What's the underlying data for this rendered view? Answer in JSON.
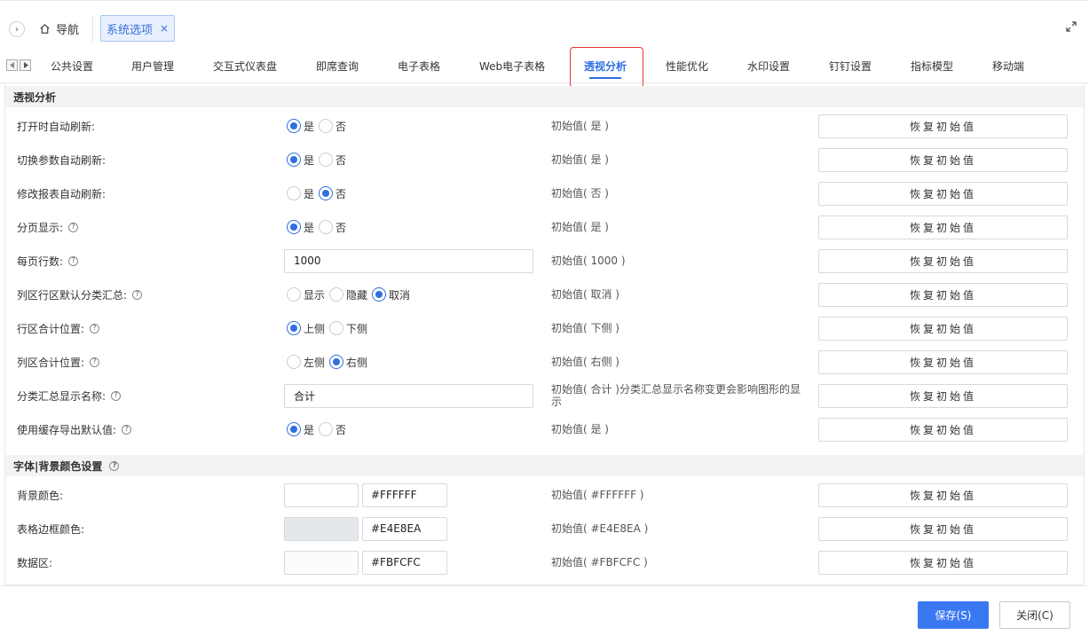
{
  "topbar": {
    "nav_label": "导航",
    "open_tab_label": "系统选项",
    "close_glyph": "×",
    "toggle_glyph": "›"
  },
  "tabs": [
    {
      "label": "公共设置"
    },
    {
      "label": "用户管理"
    },
    {
      "label": "交互式仪表盘"
    },
    {
      "label": "即席查询"
    },
    {
      "label": "电子表格"
    },
    {
      "label": "Web电子表格"
    },
    {
      "label": "透视分析",
      "active": true
    },
    {
      "label": "性能优化"
    },
    {
      "label": "水印设置"
    },
    {
      "label": "钉钉设置"
    },
    {
      "label": "指标模型"
    },
    {
      "label": "移动端"
    }
  ],
  "section1": {
    "title": "透视分析"
  },
  "rows": [
    {
      "label": "打开时自动刷新:",
      "options": [
        "是",
        "否"
      ],
      "selected": 0,
      "initial": "初始值( 是 )"
    },
    {
      "label": "切换参数自动刷新:",
      "options": [
        "是",
        "否"
      ],
      "selected": 0,
      "initial": "初始值( 是 )"
    },
    {
      "label": "修改报表自动刷新:",
      "options": [
        "是",
        "否"
      ],
      "selected": 1,
      "initial": "初始值( 否 )"
    },
    {
      "label": "分页显示:",
      "options": [
        "是",
        "否"
      ],
      "selected": 0,
      "initial": "初始值( 是 )",
      "help": true
    },
    {
      "label": "每页行数:",
      "value": "1000",
      "initial": "初始值( 1000 )",
      "help": true
    },
    {
      "label": "列区行区默认分类汇总:",
      "options": [
        "显示",
        "隐藏",
        "取消"
      ],
      "selected": 2,
      "initial": "初始值( 取消 )",
      "help": true
    },
    {
      "label": "行区合计位置:",
      "options": [
        "上侧",
        "下侧"
      ],
      "selected": 0,
      "initial": "初始值( 下侧 )",
      "help": true
    },
    {
      "label": "列区合计位置:",
      "options": [
        "左侧",
        "右侧"
      ],
      "selected": 1,
      "initial": "初始值( 右侧 )",
      "help": true
    },
    {
      "label": "分类汇总显示名称:",
      "value": "合计",
      "initial": "初始值( 合计 )分类汇总显示名称变更会影响图形的显示",
      "help": true
    },
    {
      "label": "使用缓存导出默认值:",
      "options": [
        "是",
        "否"
      ],
      "selected": 0,
      "initial": "初始值( 是 )",
      "help": true
    }
  ],
  "section2": {
    "title": "字体|背景颜色设置"
  },
  "color_rows": [
    {
      "label": "背景颜色:",
      "color": "#FFFFFF",
      "value": "#FFFFFF",
      "initial": "初始值( #FFFFFF )"
    },
    {
      "label": "表格边框颜色:",
      "color": "#E4E8EA",
      "value": "#E4E8EA",
      "initial": "初始值( #E4E8EA )"
    },
    {
      "label": "数据区:",
      "color": "#FBFCFC",
      "value": "#FBFCFC",
      "initial": "初始值( #FBFCFC )"
    }
  ],
  "reset_label": "恢复初始值",
  "footer": {
    "save_label": "保存(S)",
    "close_label": "关闭(C)"
  },
  "colors": {
    "accent": "#2f6fe0",
    "save_button": "#3a78f2",
    "highlight": "#e53935"
  }
}
